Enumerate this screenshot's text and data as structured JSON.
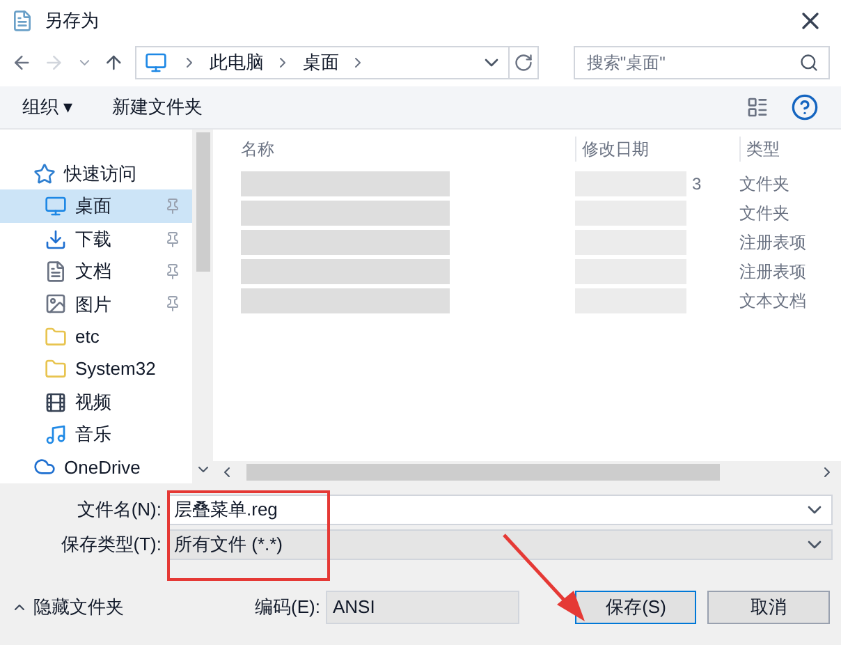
{
  "window": {
    "title": "另存为"
  },
  "address": {
    "path": [
      {
        "label": "此电脑"
      },
      {
        "label": "桌面"
      }
    ]
  },
  "search": {
    "placeholder": "搜索\"桌面\""
  },
  "toolbar": {
    "organize": "组织 ▾",
    "new_folder": "新建文件夹"
  },
  "sidebar": {
    "items": [
      {
        "label": "快速访问",
        "kind": "star",
        "pinned": false,
        "selected": false
      },
      {
        "label": "桌面",
        "kind": "desktop",
        "pinned": true,
        "selected": true
      },
      {
        "label": "下载",
        "kind": "download",
        "pinned": true,
        "selected": false
      },
      {
        "label": "文档",
        "kind": "document",
        "pinned": true,
        "selected": false
      },
      {
        "label": "图片",
        "kind": "picture",
        "pinned": true,
        "selected": false
      },
      {
        "label": "etc",
        "kind": "folder",
        "pinned": false,
        "selected": false
      },
      {
        "label": "System32",
        "kind": "folder",
        "pinned": false,
        "selected": false
      },
      {
        "label": "视频",
        "kind": "video",
        "pinned": false,
        "selected": false
      },
      {
        "label": "音乐",
        "kind": "music",
        "pinned": false,
        "selected": false
      },
      {
        "label": "OneDrive",
        "kind": "cloud",
        "pinned": false,
        "selected": false
      }
    ]
  },
  "table": {
    "columns": [
      "名称",
      "修改日期",
      "类型"
    ],
    "rows": [
      {
        "date": "3",
        "type": "文件夹"
      },
      {
        "type": "文件夹"
      },
      {
        "type": "注册表项"
      },
      {
        "type": "注册表项"
      },
      {
        "type": "文本文档"
      }
    ]
  },
  "form": {
    "filename_label": "文件名(N):",
    "filename": "层叠菜单.reg",
    "type_label": "保存类型(T):",
    "type": "所有文件 (*.*)",
    "encoding_label": "编码(E):",
    "encoding": "ANSI"
  },
  "hide_folders": "隐藏文件夹",
  "buttons": [
    {
      "label": "保存(S)",
      "selected": true
    },
    {
      "label": "取消",
      "selected": false
    }
  ]
}
